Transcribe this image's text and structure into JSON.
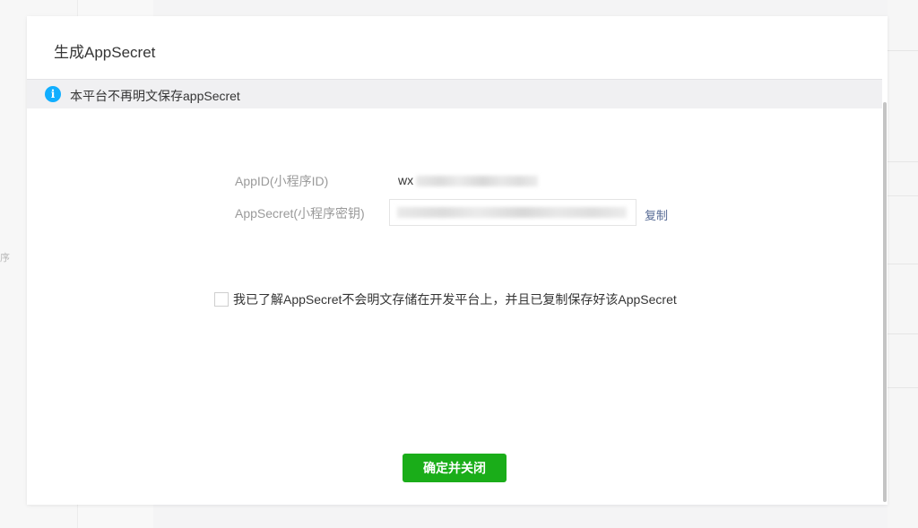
{
  "dialog": {
    "title": "生成AppSecret",
    "notice": "本平台不再明文保存appSecret",
    "notice_icon": "info-icon",
    "appid_label": "AppID(小程序ID)",
    "appid_value_visible": "wx",
    "secret_label": "AppSecret(小程序密钥)",
    "copy_label": "复制",
    "agree_text": "我已了解AppSecret不会明文存储在开发平台上，并且已复制保存好该AppSecret",
    "agree_checked": false,
    "confirm_label": "确定并关闭"
  },
  "background": {
    "left_fragment": "序"
  },
  "colors": {
    "accent_green": "#1aad19",
    "info_blue": "#10aeff",
    "link_blue": "#576b95"
  }
}
